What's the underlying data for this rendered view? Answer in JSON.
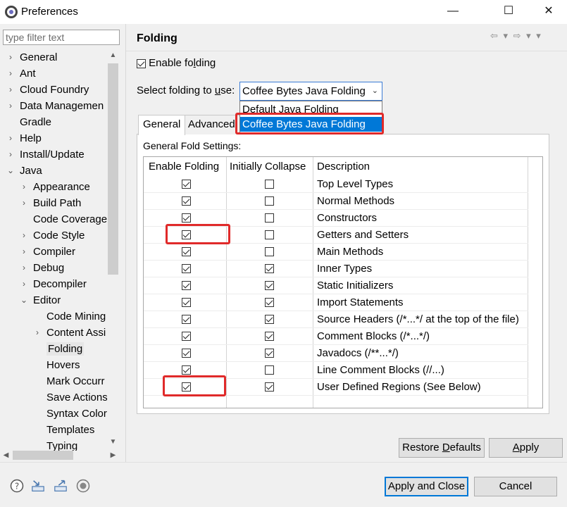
{
  "window": {
    "title": "Preferences",
    "minimize": "—",
    "maximize": "☐",
    "close": "✕"
  },
  "filter": {
    "placeholder": "type filter text"
  },
  "tree": [
    {
      "label": "General",
      "chev": "›",
      "level": 0
    },
    {
      "label": "Ant",
      "chev": "›",
      "level": 0
    },
    {
      "label": "Cloud Foundry",
      "chev": "›",
      "level": 0
    },
    {
      "label": "Data Managemen",
      "chev": "›",
      "level": 0
    },
    {
      "label": "Gradle",
      "chev": "",
      "level": 0
    },
    {
      "label": "Help",
      "chev": "›",
      "level": 0
    },
    {
      "label": "Install/Update",
      "chev": "›",
      "level": 0
    },
    {
      "label": "Java",
      "chev": "⌄",
      "level": 0
    },
    {
      "label": "Appearance",
      "chev": "›",
      "level": 1
    },
    {
      "label": "Build Path",
      "chev": "›",
      "level": 1
    },
    {
      "label": "Code Coverage",
      "chev": "",
      "level": 1
    },
    {
      "label": "Code Style",
      "chev": "›",
      "level": 1
    },
    {
      "label": "Compiler",
      "chev": "›",
      "level": 1
    },
    {
      "label": "Debug",
      "chev": "›",
      "level": 1
    },
    {
      "label": "Decompiler",
      "chev": "›",
      "level": 1
    },
    {
      "label": "Editor",
      "chev": "⌄",
      "level": 1
    },
    {
      "label": "Code Mining",
      "chev": "",
      "level": 2
    },
    {
      "label": "Content Assi",
      "chev": "›",
      "level": 2
    },
    {
      "label": "Folding",
      "chev": "",
      "level": 2,
      "selected": true
    },
    {
      "label": "Hovers",
      "chev": "",
      "level": 2
    },
    {
      "label": "Mark Occurr",
      "chev": "",
      "level": 2
    },
    {
      "label": "Save Actions",
      "chev": "",
      "level": 2
    },
    {
      "label": "Syntax Color",
      "chev": "",
      "level": 2
    },
    {
      "label": "Templates",
      "chev": "",
      "level": 2
    },
    {
      "label": "Typing",
      "chev": "",
      "level": 2
    }
  ],
  "page": {
    "title": "Folding",
    "nav_icons": "⇦ ▾ ⇨ ▾ ▾",
    "enable_folding_pre": "Enable fo",
    "enable_folding_u": "l",
    "enable_folding_post": "ding",
    "enable_folding_checked": true,
    "select_label_pre": "Select folding to ",
    "select_label_u": "u",
    "select_label_post": "se:",
    "combo_value": "Coffee Bytes Java Folding",
    "combo_arrow": "⌄",
    "dropdown_options": [
      "Default Java Folding",
      "Coffee Bytes Java Folding"
    ],
    "dropdown_selected_index": 1
  },
  "tabs": [
    {
      "label": "General",
      "active": true
    },
    {
      "label": "Advanced",
      "active": false
    }
  ],
  "general_fold_settings_label": "General Fold Settings:",
  "table": {
    "headers": [
      "Enable Folding",
      "Initially Collapse",
      "Description"
    ],
    "rows": [
      {
        "enable": true,
        "collapse": false,
        "desc": "Top Level Types"
      },
      {
        "enable": true,
        "collapse": false,
        "desc": "Normal Methods"
      },
      {
        "enable": true,
        "collapse": false,
        "desc": "Constructors"
      },
      {
        "enable": true,
        "collapse": false,
        "desc": "Getters and Setters"
      },
      {
        "enable": true,
        "collapse": false,
        "desc": "Main Methods"
      },
      {
        "enable": true,
        "collapse": true,
        "desc": "Inner Types"
      },
      {
        "enable": true,
        "collapse": true,
        "desc": "Static Initializers"
      },
      {
        "enable": true,
        "collapse": true,
        "desc": "Import Statements"
      },
      {
        "enable": true,
        "collapse": true,
        "desc": "Source Headers (/*...*/ at the top of the file)"
      },
      {
        "enable": true,
        "collapse": true,
        "desc": "Comment Blocks (/*...*/)"
      },
      {
        "enable": true,
        "collapse": true,
        "desc": "Javadocs (/**...*/)"
      },
      {
        "enable": true,
        "collapse": false,
        "desc": "Line Comment Blocks (//...)"
      },
      {
        "enable": true,
        "collapse": true,
        "desc": "User Defined Regions (See Below)"
      }
    ]
  },
  "buttons": {
    "restore_pre": "Restore ",
    "restore_u": "D",
    "restore_post": "efaults",
    "apply_pre": "",
    "apply_u": "A",
    "apply_post": "pply",
    "apply_close": "Apply and Close",
    "cancel": "Cancel"
  },
  "colors": {
    "highlight_red": "#e02a2a",
    "selection_blue": "#0078d7"
  },
  "footer_icons": [
    "help-icon",
    "import-icon",
    "export-icon",
    "record-icon"
  ]
}
